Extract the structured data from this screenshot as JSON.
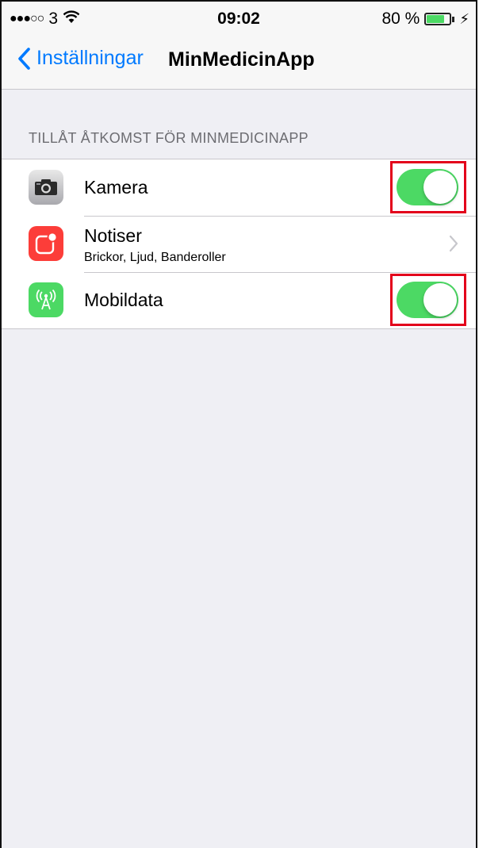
{
  "status_bar": {
    "signal": "●●●○○",
    "carrier": "3",
    "wifi_icon": "wifi-icon",
    "time": "09:02",
    "battery_text": "80 %",
    "battery_level": 0.8,
    "charging_icon": "bolt-icon"
  },
  "nav": {
    "back_label": "Inställningar",
    "title": "MinMedicinApp"
  },
  "section": {
    "header": "TILLÅT ÅTKOMST FÖR MINMEDICINAPP"
  },
  "rows": [
    {
      "icon": "camera-icon",
      "label": "Kamera",
      "control": "toggle",
      "on": true,
      "highlighted": true
    },
    {
      "icon": "notifications-icon",
      "label": "Notiser",
      "sublabel": "Brickor, Ljud, Banderoller",
      "control": "chevron"
    },
    {
      "icon": "cellular-data-icon",
      "label": "Mobildata",
      "control": "toggle",
      "on": true,
      "highlighted": true
    }
  ],
  "colors": {
    "accent": "#007aff",
    "toggle_on": "#4cd964",
    "highlight": "#e3001b",
    "notifications": "#fc3d39"
  }
}
